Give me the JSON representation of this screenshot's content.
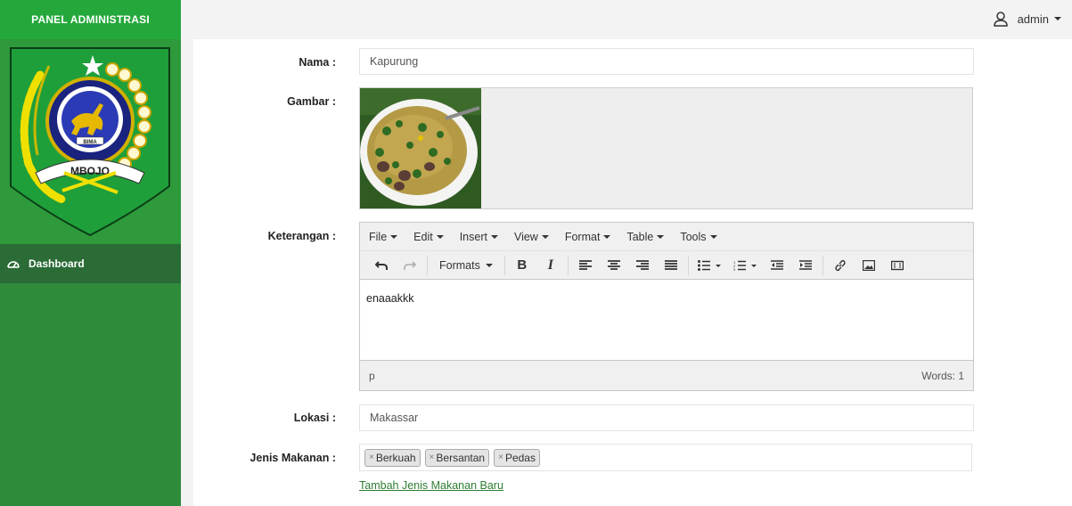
{
  "sidebar": {
    "brand": "PANEL ADMINISTRASI",
    "logo_text_top": "BIMA",
    "logo_text_ribbon": "MBOJO",
    "nav": [
      {
        "label": "Dashboard",
        "icon": "dashboard-icon"
      }
    ]
  },
  "topbar": {
    "user_label": "admin",
    "user_icon": "user-icon"
  },
  "form": {
    "nama_label": "Nama :",
    "nama_value": "Kapurung",
    "gambar_label": "Gambar :",
    "keterangan_label": "Keterangan :",
    "lokasi_label": "Lokasi :",
    "lokasi_value": "Makassar",
    "jenis_label": "Jenis Makanan :",
    "tags": [
      "Berkuah",
      "Bersantan",
      "Pedas"
    ],
    "tag_remove": "×",
    "add_link": "Tambah Jenis Makanan Baru"
  },
  "editor": {
    "menus": [
      "File",
      "Edit",
      "Insert",
      "View",
      "Format",
      "Table",
      "Tools"
    ],
    "formats_label": "Formats",
    "content": "enaaakkk",
    "path": "p",
    "word_count": "Words: 1"
  },
  "colors": {
    "sidebar": "#2e8b3a",
    "brand": "#24a83b",
    "nav_active": "#2a6b36",
    "link": "#2e7d32"
  }
}
